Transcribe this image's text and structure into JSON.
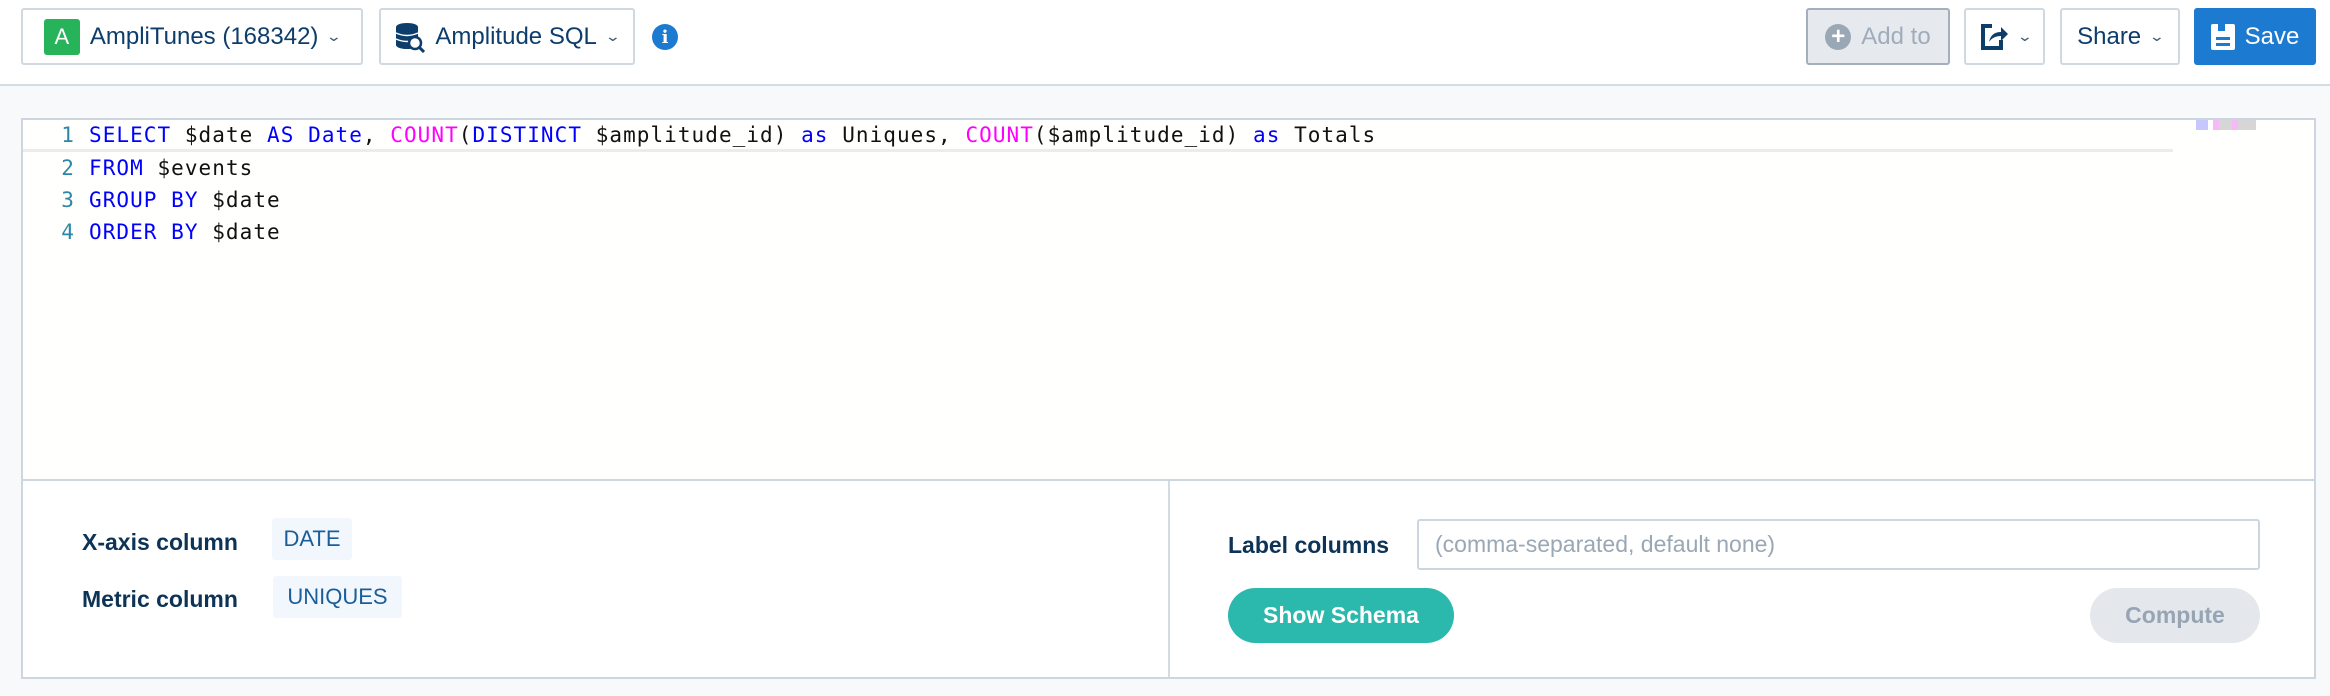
{
  "header": {
    "project": {
      "badge": "A",
      "label": "AmpliTunes (168342)",
      "badge_color": "#27b35a"
    },
    "datasource": {
      "label": "Amplitude SQL",
      "icon": "database-search-icon"
    },
    "info_icon": "i",
    "add_to_label": "Add to",
    "share_label": "Share",
    "save_label": "Save",
    "accent": "#1d7ad1"
  },
  "editor": {
    "lines": [
      {
        "num": "1",
        "tokens": [
          {
            "t": "SELECT",
            "c": "kw"
          },
          {
            "t": " $date "
          },
          {
            "t": "AS",
            "c": "kw"
          },
          {
            "t": " "
          },
          {
            "t": "Date",
            "c": "kw"
          },
          {
            "t": ", "
          },
          {
            "t": "COUNT",
            "c": "fn"
          },
          {
            "t": "("
          },
          {
            "t": "DISTINCT",
            "c": "kw"
          },
          {
            "t": " $amplitude_id) "
          },
          {
            "t": "as",
            "c": "kw"
          },
          {
            "t": " Uniques, "
          },
          {
            "t": "COUNT",
            "c": "fn"
          },
          {
            "t": "($amplitude_id) "
          },
          {
            "t": "as",
            "c": "kw"
          },
          {
            "t": " Totals"
          }
        ]
      },
      {
        "num": "2",
        "tokens": [
          {
            "t": "FROM",
            "c": "kw"
          },
          {
            "t": " $events"
          }
        ]
      },
      {
        "num": "3",
        "tokens": [
          {
            "t": "GROUP BY",
            "c": "kw"
          },
          {
            "t": " $date"
          }
        ]
      },
      {
        "num": "4",
        "tokens": [
          {
            "t": "ORDER BY",
            "c": "kw"
          },
          {
            "t": " $date"
          }
        ]
      }
    ]
  },
  "settings": {
    "x_axis_label": "X-axis column",
    "x_axis_value": "DATE",
    "metric_label": "Metric column",
    "metric_value": "UNIQUES",
    "label_columns_label": "Label columns",
    "label_columns_placeholder": "(comma-separated, default none)",
    "show_schema_label": "Show Schema",
    "compute_label": "Compute",
    "teal": "#2bb9ad"
  }
}
